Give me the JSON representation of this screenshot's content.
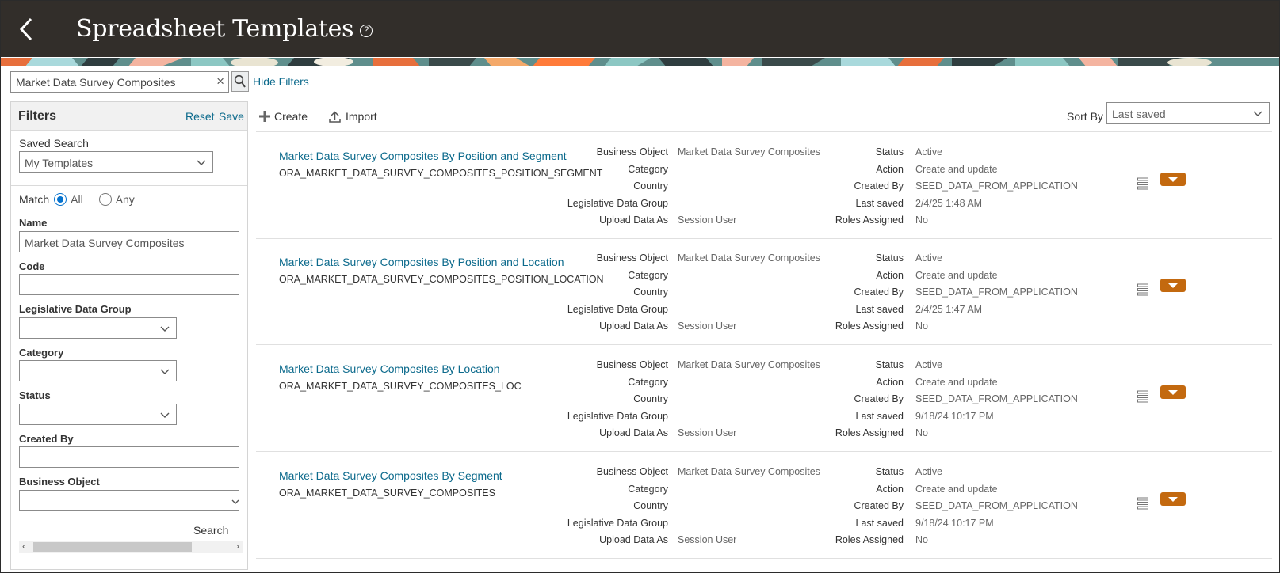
{
  "header": {
    "title": "Spreadsheet Templates",
    "help_glyph": "?"
  },
  "search": {
    "value": "Market Data Survey Composites",
    "clear_glyph": "×",
    "hide_filters": "Hide Filters"
  },
  "filters": {
    "title": "Filters",
    "reset": "Reset",
    "save": "Save",
    "saved_search_label": "Saved Search",
    "saved_search_value": "My Templates",
    "match_label": "Match",
    "match_all": "All",
    "match_any": "Any",
    "match_selected": "All",
    "name_label": "Name",
    "name_value": "Market Data Survey Composites",
    "code_label": "Code",
    "code_value": "",
    "ldg_label": "Legislative Data Group",
    "ldg_value": "",
    "category_label": "Category",
    "category_value": "",
    "status_label": "Status",
    "status_value": "",
    "created_by_label": "Created By",
    "created_by_value": "",
    "business_object_label": "Business Object",
    "business_object_value": "",
    "search_button": "Search",
    "scroll_left_glyph": "‹",
    "scroll_right_glyph": "›"
  },
  "toolbar": {
    "create": "Create",
    "import": "Import",
    "sort_by_label": "Sort By",
    "sort_by_value": "Last saved"
  },
  "field_labels": {
    "business_object": "Business Object",
    "category": "Category",
    "country": "Country",
    "ldg": "Legislative Data Group",
    "upload_data_as": "Upload Data As",
    "status": "Status",
    "action": "Action",
    "created_by": "Created By",
    "last_saved": "Last saved",
    "roles_assigned": "Roles Assigned"
  },
  "templates": [
    {
      "name": "Market Data Survey Composites By Position and Segment",
      "code": "ORA_MARKET_DATA_SURVEY_COMPOSITES_POSITION_SEGMENT",
      "business_object": "Market Data Survey Composites",
      "category": "",
      "country": "",
      "ldg": "",
      "upload_data_as": "Session User",
      "status": "Active",
      "action": "Create and update",
      "created_by": "SEED_DATA_FROM_APPLICATION",
      "last_saved": "2/4/25 1:48 AM",
      "roles_assigned": "No"
    },
    {
      "name": "Market Data Survey Composites By Position and Location",
      "code": "ORA_MARKET_DATA_SURVEY_COMPOSITES_POSITION_LOCATION",
      "business_object": "Market Data Survey Composites",
      "category": "",
      "country": "",
      "ldg": "",
      "upload_data_as": "Session User",
      "status": "Active",
      "action": "Create and update",
      "created_by": "SEED_DATA_FROM_APPLICATION",
      "last_saved": "2/4/25 1:47 AM",
      "roles_assigned": "No"
    },
    {
      "name": "Market Data Survey Composites By Location",
      "code": "ORA_MARKET_DATA_SURVEY_COMPOSITES_LOC",
      "business_object": "Market Data Survey Composites",
      "category": "",
      "country": "",
      "ldg": "",
      "upload_data_as": "Session User",
      "status": "Active",
      "action": "Create and update",
      "created_by": "SEED_DATA_FROM_APPLICATION",
      "last_saved": "9/18/24 10:17 PM",
      "roles_assigned": "No"
    },
    {
      "name": "Market Data Survey Composites By Segment",
      "code": "ORA_MARKET_DATA_SURVEY_COMPOSITES",
      "business_object": "Market Data Survey Composites",
      "category": "",
      "country": "",
      "ldg": "",
      "upload_data_as": "Session User",
      "status": "Active",
      "action": "Create and update",
      "created_by": "SEED_DATA_FROM_APPLICATION",
      "last_saved": "9/18/24 10:17 PM",
      "roles_assigned": "No"
    }
  ],
  "colors": {
    "header_bg": "#322e2a",
    "link": "#0c6a8c",
    "action_button": "#c3690f",
    "radio_selected": "#0572ce"
  }
}
